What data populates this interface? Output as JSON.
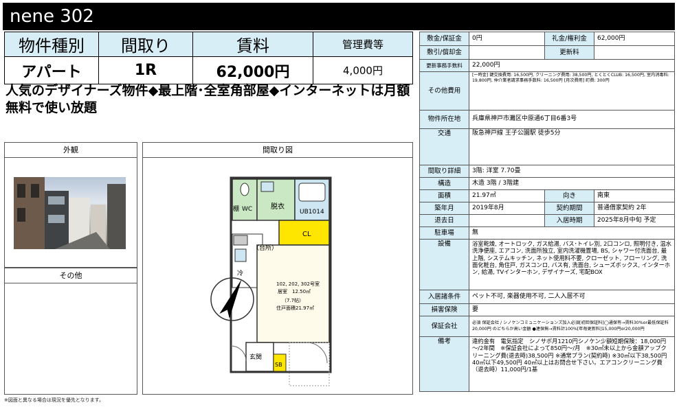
{
  "title": "nene 302",
  "main": {
    "headers": [
      "物件種別",
      "間取り",
      "賃料",
      "管理費等"
    ],
    "values": [
      "アパート",
      "1R",
      "62,000円",
      "4,000円"
    ]
  },
  "catchcopy": "人気のデザイナーズ物件◆最上階･全室角部屋◆インターネットは月額無料で使い放題",
  "panels": {
    "exterior": "外観",
    "floorplan": "間取り図",
    "other": "その他"
  },
  "floorplan": {
    "storage": "棚",
    "wc": "WC",
    "washroom": "脱衣",
    "bath": "UB1014",
    "closet": "CL",
    "kitchen": "（台所）",
    "fridge": "冷",
    "room_line1": "102, 202, 302号室",
    "room_line2": "居室　12.50㎡",
    "room_line3": "（7.7帖）",
    "room_line4": "住戸面積21.97㎡",
    "entrance": "玄関",
    "shoebox": "SB"
  },
  "info": {
    "deposit_label": "敷金/保証金",
    "deposit_value": "0円",
    "key_money_label": "礼金/権利金",
    "key_money_value": "62,000円",
    "amort_label": "敷引/償却金",
    "amort_value": "",
    "renewal_label": "更新料",
    "renewal_value": "",
    "renewal_fee_label": "更新事務手数料",
    "renewal_fee_value": "22,000円",
    "other_cost_label": "その他費用",
    "other_cost_value": "[一時金] 鍵交換費用: 16,500円, クリーニング費用: 38,500円, とくとくCLUB: 16,500円, 室内消毒料: 19,800円, 仲介業者請求事務手数料: 16,500円 [月次費用] 町費: 300円",
    "address_label": "物件所在地",
    "address_value": "兵庫県神戸市灘区中原通6丁目6番3号",
    "transport_label": "交通",
    "transport_value": "阪急神戸線 王子公園駅 徒歩5分",
    "layout_label": "間取り詳細",
    "layout_value": "3階: 洋室 7.70畳",
    "structure_label": "構造",
    "structure_value": "木造 3階 / 3階建",
    "area_label": "面積",
    "area_value": "21.97㎡",
    "direction_label": "向き",
    "direction_value": "南東",
    "built_label": "築年月",
    "built_value": "2019年8月",
    "contract_label": "契約期間",
    "contract_value": "普通借家契約 2年",
    "vacate_label": "退去日",
    "vacate_value": "",
    "movein_label": "入居時期",
    "movein_value": "2025年8月中旬 予定",
    "parking_label": "駐車場",
    "parking_value": "無",
    "equipment_label": "設備",
    "equipment_value": "浴室乾燥, オートロック, ガス給湯, バス･トイレ別, 2口コンロ, 照明付き, 温水洗浄便座, エアコン, 洗面所独立, 室内洗濯機置場, BS, シャワー付洗面台, 最上階, システムキッチン, ネット使用料不要, クローゼット, フローリング, 洗面化粧台, 角住戸, ガスコンロ, バス有, 洗面台, シューズボックス, インターホン, 給湯, TVインターホン, デザイナーズ, 宅配BOX",
    "conditions_label": "入居諸条件",
    "conditions_value": "ペット不可, 楽器使用不可, 二人入居不可",
    "insurance_label": "損害保険",
    "insurance_value": "要",
    "guarantor_label": "保証会社",
    "guarantor_value": "必須 保証会社 / シノケンコミュニケーションズ加入必須[初回保証料]◯通保有→賃料30%or最低保証料20,000円 のどちらか高い金額 ●連保無→賃料計100%[年毎更新料]15,000円or20,000円",
    "remarks_label": "備考",
    "remarks_value": "違約金有　電気指定　シノサポ月1210円シノケン少額短期保険：18,000円～/2年間　※保証会社によって850円～/月　※30㎡未以上から金額アップクリーニング費(退去時)38,500円 ※通常プラン(契約時) ※30㎡以下38,500円 40㎡以下49,500円 40㎡以上はお問合せ下さい。エアコンクリーニング費（退去時）11,000円/1基"
  },
  "footnote": "※図面と異なる場合は現況を優先となります。"
}
